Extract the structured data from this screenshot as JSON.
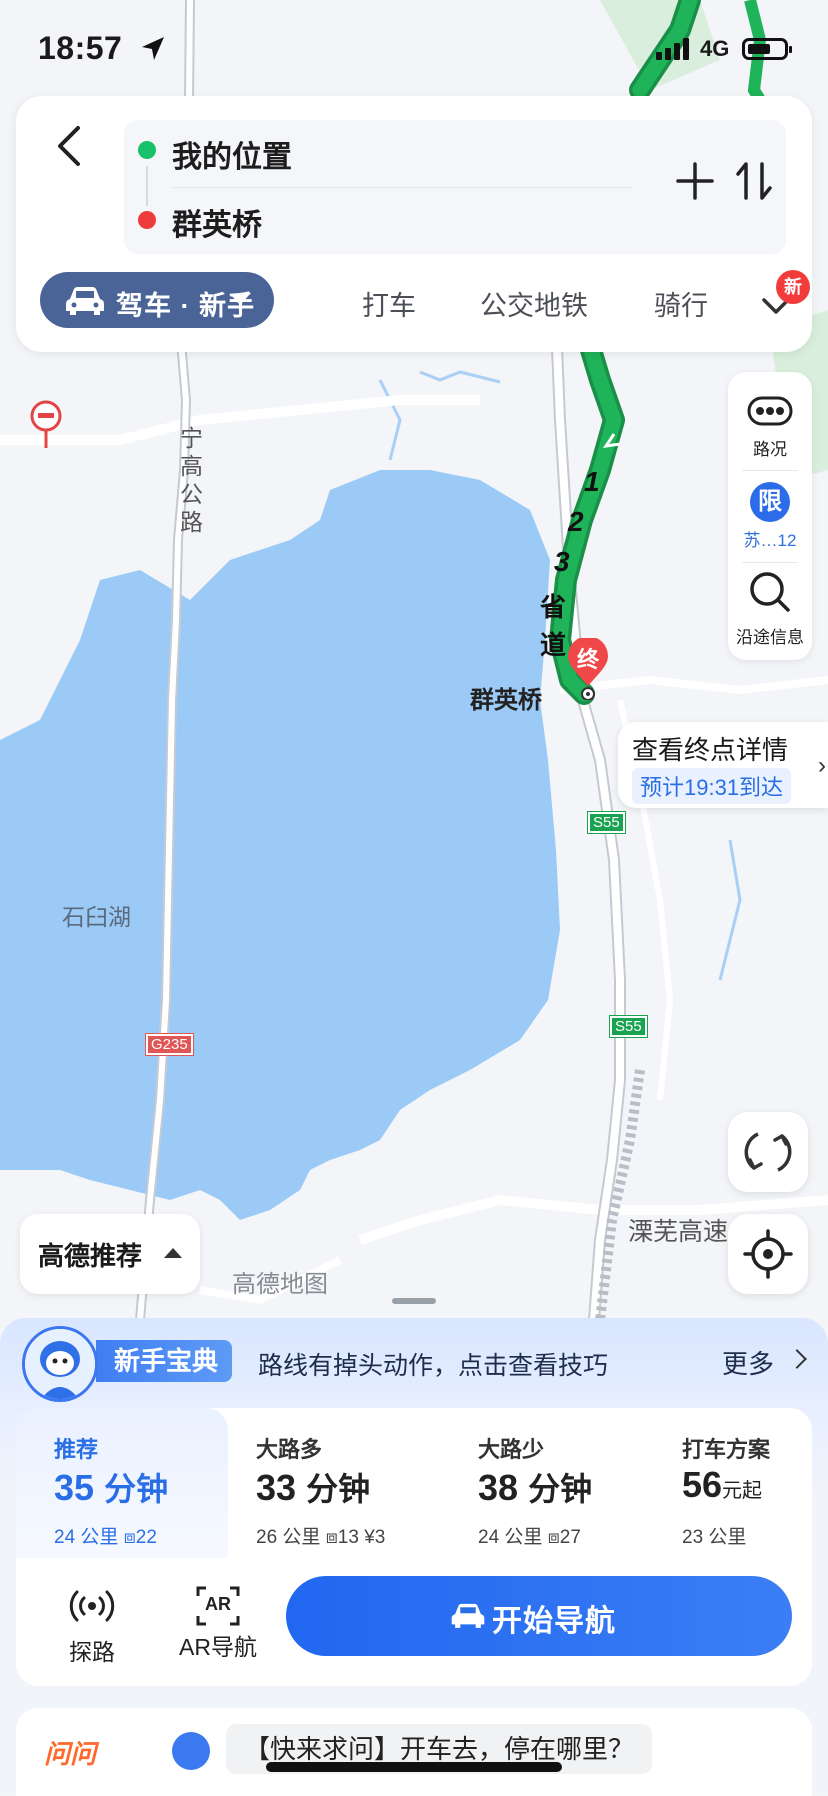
{
  "status_bar": {
    "time": "18:57",
    "network": "4G"
  },
  "route": {
    "origin": "我的位置",
    "destination": "群英桥"
  },
  "modes": {
    "drive_label": "驾车 · 新手",
    "taxi": "打车",
    "transit": "公交地铁",
    "bike": "骑行",
    "new_badge": "新"
  },
  "side_tools": {
    "traffic": "路况",
    "restrict_icon": "限",
    "restrict_label": "苏…12",
    "along_route": "沿途信息"
  },
  "map": {
    "dest_marker": "终",
    "dest_name": "群英桥",
    "lake_name": "石臼湖",
    "road_ninggao": "宁高公路",
    "road_provincial": "省道",
    "route_numbers": [
      "1",
      "2",
      "3"
    ],
    "road_g235": "G235",
    "road_s55": "S55",
    "road_liwu": "溧芜高速",
    "watermark": "高德地图"
  },
  "dest_callout": {
    "title": "查看终点详情",
    "eta": "预计19:31到达"
  },
  "recommend_toggle": "高德推荐",
  "tip": {
    "tag": "新手宝典",
    "text": "路线有掉头动作，点击查看技巧",
    "more": "更多"
  },
  "options": [
    {
      "name": "推荐",
      "duration": "35",
      "unit": "分钟",
      "distance": "24 公里",
      "lights": "22",
      "toll": ""
    },
    {
      "name": "大路多",
      "duration": "33",
      "unit": "分钟",
      "distance": "26 公里",
      "lights": "13",
      "toll": "¥3"
    },
    {
      "name": "大路少",
      "duration": "38",
      "unit": "分钟",
      "distance": "24 公里",
      "lights": "27",
      "toll": ""
    },
    {
      "name": "打车方案",
      "duration": "56",
      "unit": "元起",
      "distance": "23 公里",
      "lights": "",
      "toll": ""
    }
  ],
  "actions": {
    "explore": "探路",
    "ar_nav": "AR导航",
    "ar_icon_text": "AR",
    "start_nav": "开始导航"
  },
  "ask": {
    "logo": "问问",
    "prompt": "【快来求问】开车去，停在哪里？"
  },
  "colors": {
    "route_green": "#1fb35a",
    "lake_blue": "#9ccaf6",
    "accent_blue": "#2a6ee6",
    "mode_pill": "#4a6497"
  }
}
